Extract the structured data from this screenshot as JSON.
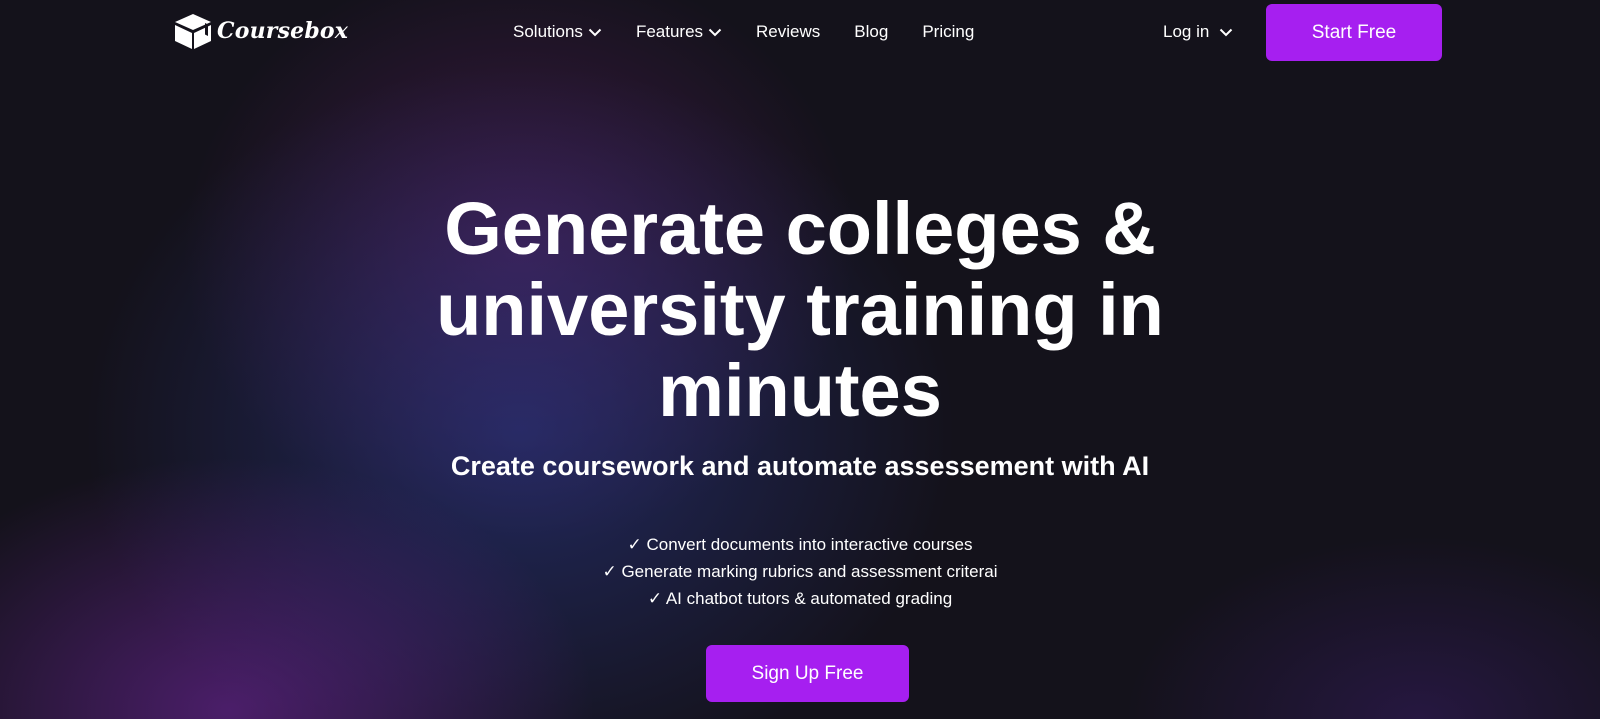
{
  "nav": {
    "logo_text": "Coursebox",
    "links": [
      {
        "label": "Solutions",
        "has_dropdown": true
      },
      {
        "label": "Features",
        "has_dropdown": true
      },
      {
        "label": "Reviews",
        "has_dropdown": false
      },
      {
        "label": "Blog",
        "has_dropdown": false
      },
      {
        "label": "Pricing",
        "has_dropdown": false
      }
    ],
    "login_label": "Log in",
    "start_free_label": "Start Free"
  },
  "hero": {
    "title": "Generate colleges & university training in minutes",
    "subtitle": "Create coursework and automate assessement with AI",
    "features": [
      "✓ Convert documents into interactive courses",
      "✓ Generate marking rubrics and assessment criterai",
      "✓ AI chatbot tutors & automated grading"
    ],
    "cta_label": "Sign Up Free"
  },
  "colors": {
    "accent": "#a61ff0",
    "background": "#14121b",
    "text": "#ffffff"
  },
  "icons": {
    "logo": "box-icon",
    "dropdown": "chevron-down-icon"
  }
}
